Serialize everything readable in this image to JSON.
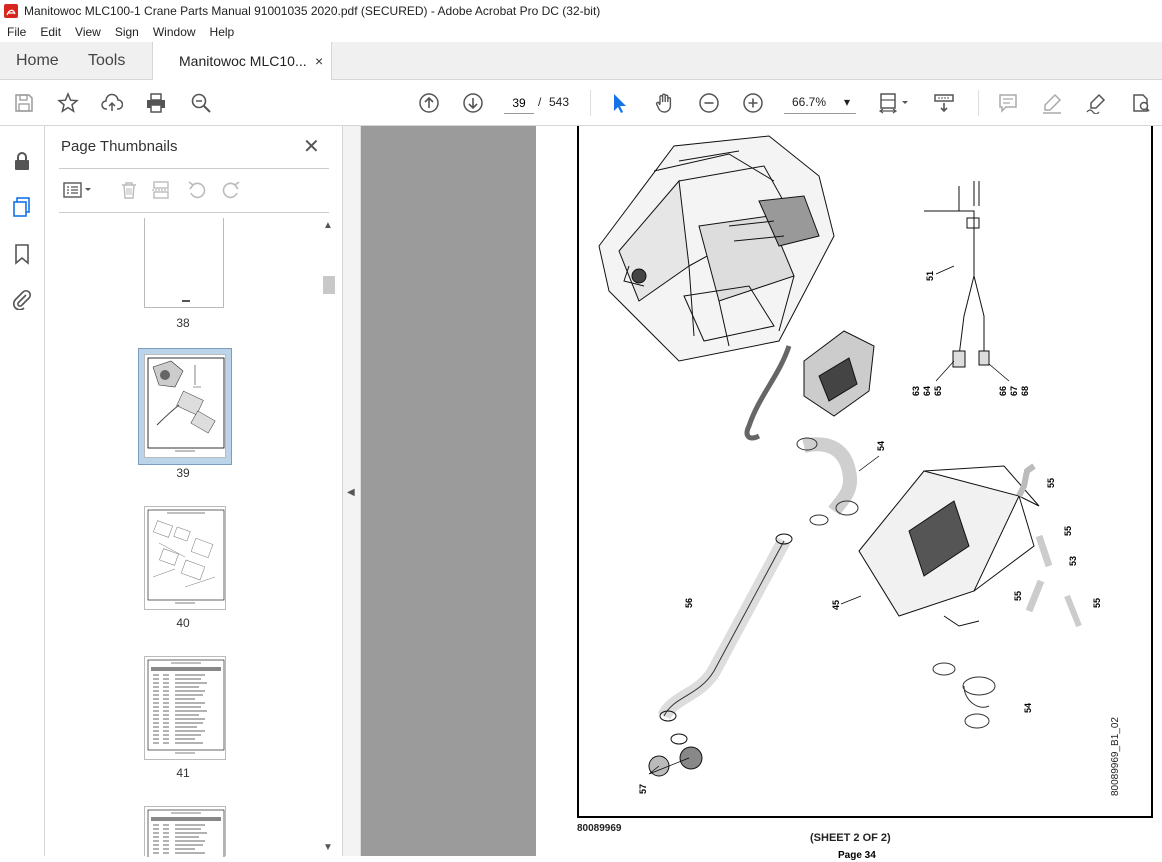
{
  "window": {
    "title": "Manitowoc MLC100-1 Crane Parts Manual 91001035 2020.pdf (SECURED) - Adobe Acrobat Pro DC (32-bit)"
  },
  "menu": [
    "File",
    "Edit",
    "View",
    "Sign",
    "Window",
    "Help"
  ],
  "tabs": {
    "home": "Home",
    "tools": "Tools",
    "document": "Manitowoc MLC10...",
    "close": "×"
  },
  "toolbar": {
    "current_page": "39",
    "page_sep": "/",
    "total_pages": "543",
    "zoom": "66.7%",
    "zoom_caret": "▾"
  },
  "panel": {
    "title": "Page Thumbnails",
    "close": "✕",
    "thumbnails": [
      {
        "label": "38"
      },
      {
        "label": "39",
        "selected": true
      },
      {
        "label": "40"
      },
      {
        "label": "41"
      }
    ]
  },
  "document": {
    "callouts": [
      "51",
      "63",
      "64",
      "65",
      "66",
      "67",
      "68",
      "54",
      "55",
      "55",
      "53",
      "55",
      "55",
      "56",
      "45",
      "54",
      "57"
    ],
    "drawing_id": "80089969_B1_02",
    "doc_code": "80089969",
    "sheet": "(SHEET 2 OF 2)",
    "page_foot": "Page 34"
  },
  "colors": {
    "accent": "#1473e6",
    "viewer_bg": "#9b9b9b",
    "selection": "#bcd4ea"
  }
}
